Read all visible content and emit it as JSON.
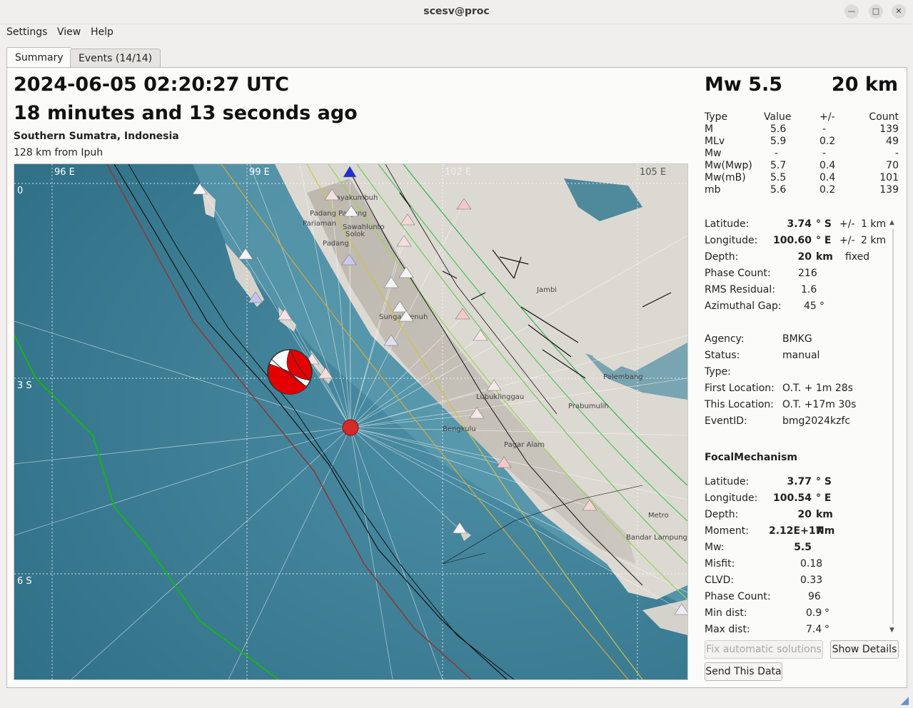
{
  "window": {
    "title": "scesv@proc"
  },
  "menu": {
    "settings": "Settings",
    "view": "View",
    "help": "Help"
  },
  "tabs": {
    "summary": "Summary",
    "events": "Events (14/14)"
  },
  "event": {
    "time": "2024-06-05 02:20:27 UTC",
    "ago": "18 minutes and 13 seconds ago",
    "region": "Southern Sumatra, Indonesia",
    "nearest": "128 km from Ipuh"
  },
  "headline": {
    "magnitude": "Mw 5.5",
    "depth": "20 km"
  },
  "magnitudes": {
    "headers": [
      "Type",
      "Value",
      "+/-",
      "Count"
    ],
    "rows": [
      [
        "M",
        "5.6",
        "-",
        "139"
      ],
      [
        "MLv",
        "5.9",
        "0.2",
        "49"
      ],
      [
        "Mw",
        "-",
        "-",
        "-"
      ],
      [
        "Mw(Mwp)",
        "5.7",
        "0.4",
        "70"
      ],
      [
        "Mw(mB)",
        "5.5",
        "0.4",
        "101"
      ],
      [
        "mb",
        "5.6",
        "0.2",
        "139"
      ]
    ]
  },
  "origin": {
    "latitude_label": "Latitude:",
    "latitude_value": "3.74",
    "latitude_unit": "° S",
    "latitude_pm": "+/-",
    "latitude_err": "1 km",
    "longitude_label": "Longitude:",
    "longitude_value": "100.60",
    "longitude_unit": "° E",
    "longitude_pm": "+/-",
    "longitude_err": "2 km",
    "depth_label": "Depth:",
    "depth_value": "20",
    "depth_unit": "km",
    "depth_note": "fixed",
    "phase_label": "Phase Count:",
    "phase_value": "216",
    "rms_label": "RMS Residual:",
    "rms_value": "1.6",
    "gap_label": "Azimuthal Gap:",
    "gap_value": "45",
    "gap_unit": "°",
    "agency_label": "Agency:",
    "agency_value": "BMKG",
    "status_label": "Status:",
    "status_value": "manual",
    "type_label": "Type:",
    "type_value": "",
    "first_label": "First Location:",
    "first_value": "O.T. + 1m 28s",
    "this_label": "This Location:",
    "this_value": "O.T. +17m 30s",
    "eventid_label": "EventID:",
    "eventid_value": "bmg2024kzfc"
  },
  "focal": {
    "heading": "FocalMechanism",
    "latitude_label": "Latitude:",
    "latitude_value": "3.77",
    "latitude_unit": "° S",
    "longitude_label": "Longitude:",
    "longitude_value": "100.54",
    "longitude_unit": "° E",
    "depth_label": "Depth:",
    "depth_value": "20",
    "depth_unit": "km",
    "moment_label": "Moment:",
    "moment_value": "2.12E+17",
    "moment_unit": "Nm",
    "mw_label": "Mw:",
    "mw_value": "5.5",
    "misfit_label": "Misfit:",
    "misfit_value": "0.18",
    "clvd_label": "CLVD:",
    "clvd_value": "0.33",
    "phase_label": "Phase Count:",
    "phase_value": "96",
    "mindist_label": "Min dist:",
    "mindist_value": "0.9",
    "mindist_unit": "°",
    "maxdist_label": "Max dist:",
    "maxdist_value": "7.4",
    "maxdist_unit": "°"
  },
  "buttons": {
    "fix": "Fix automatic solutions",
    "details": "Show Details",
    "send": "Send This Data"
  },
  "map": {
    "lon_labels": [
      "96 E",
      "99 E",
      "102 E",
      "105 E"
    ],
    "lat_labels": [
      "0",
      "3 S",
      "6 S"
    ],
    "places": [
      "Payakumbuh",
      "Padang Panjang",
      "Pariaman",
      "Sawahlunto",
      "Solok",
      "Padang",
      "Jambi",
      "Sungai Penuh",
      "Palembang",
      "Lubuklinggau",
      "Prabumulih",
      "Bengkulu",
      "Pagar Alam",
      "Metro",
      "Bandar Lampung"
    ],
    "colors": {
      "sea": "#3f7f96",
      "land": "#d9d6d0",
      "epicenter": "#d42a2a",
      "beachball": "#e30000"
    }
  }
}
